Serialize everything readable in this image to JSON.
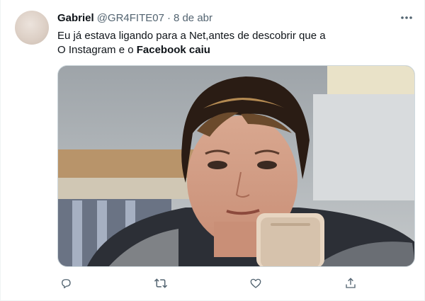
{
  "tweet": {
    "author_name": "Gabriel",
    "author_handle": "@GR4FITE07",
    "separator": "·",
    "date": "8 de abr",
    "text_line1": "Eu já estava ligando para a Net,antes de descobrir que a",
    "text_line2_prefix": "O Instagram e o ",
    "text_line2_bold": "Facebook caiu"
  },
  "icons": {
    "more": "more-horizontal-icon",
    "reply": "reply-icon",
    "retweet": "retweet-icon",
    "like": "heart-icon",
    "share": "share-icon"
  },
  "colors": {
    "text_primary": "#0f1419",
    "text_secondary": "#536471",
    "border": "#cfd9de"
  }
}
